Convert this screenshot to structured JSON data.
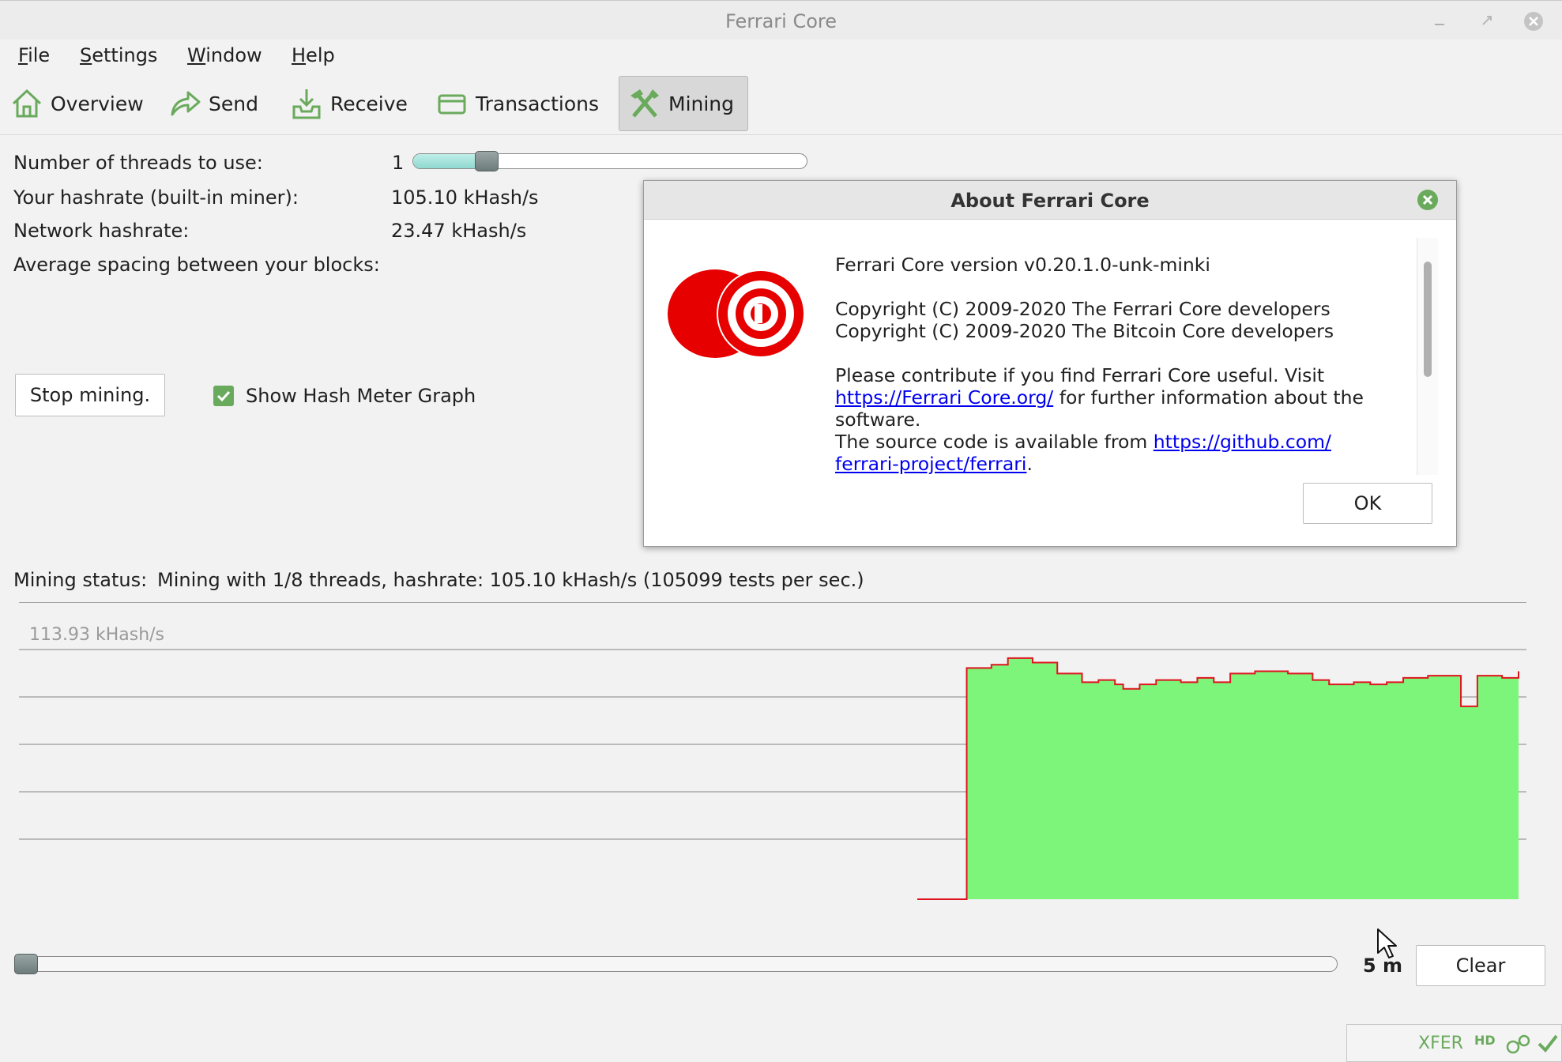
{
  "window": {
    "title": "Ferrari Core"
  },
  "menu": {
    "items": [
      {
        "mnemonic": "F",
        "rest": "ile"
      },
      {
        "mnemonic": "S",
        "rest": "ettings"
      },
      {
        "mnemonic": "W",
        "rest": "indow"
      },
      {
        "mnemonic": "H",
        "rest": "elp"
      }
    ]
  },
  "toolbar": {
    "overview": "Overview",
    "send": "Send",
    "receive": "Receive",
    "transactions": "Transactions",
    "mining": "Mining"
  },
  "mining": {
    "threads_label": "Number of threads to use:",
    "threads_value": "1",
    "threads_slider": {
      "value": 1,
      "max": 8
    },
    "hashrate_label": "Your hashrate (built-in miner):",
    "hashrate_value": "105.10 kHash/s",
    "network_label": "Network hashrate:",
    "network_value": "23.47 kHash/s",
    "spacing_label": "Average spacing between your blocks:",
    "stop_button": "Stop mining.",
    "show_graph_label": "Show Hash Meter Graph",
    "show_graph_checked": true,
    "status_label": "Mining status:",
    "status_value": "Mining with 1/8 threads, hashrate: 105.10 kHash/s (105099 tests per sec.)",
    "graph_max_label": "113.93 kHash/s",
    "interval_label": "5 m",
    "interval_slider": {
      "value": 0
    },
    "clear_button": "Clear"
  },
  "graph": {
    "max": 113.93,
    "samples": [
      0,
      0,
      0,
      0,
      0,
      0,
      105.5,
      105.5,
      105.5,
      107,
      107,
      110,
      110,
      110,
      108,
      108,
      108,
      103,
      103,
      103,
      99,
      99,
      100,
      100,
      98,
      96,
      96,
      98,
      98,
      100,
      100,
      100,
      99,
      99,
      101,
      101,
      99,
      99,
      103,
      103,
      103,
      104,
      104,
      104,
      104,
      103,
      103,
      103,
      100,
      100,
      98,
      98,
      98,
      99,
      99,
      98,
      98,
      99,
      99,
      101,
      101,
      101,
      102,
      102,
      102,
      102,
      88,
      88,
      102,
      102,
      102,
      101,
      101,
      104
    ]
  },
  "about": {
    "title": "About Ferrari Core",
    "version": "Ferrari Core version v0.20.1.0-unk-minki",
    "copyright1": "Copyright (C) 2009-2020 The Ferrari Core developers",
    "copyright2": "Copyright (C) 2009-2020 The Bitcoin Core developers",
    "contribute": "Please contribute if you find Ferrari Core useful. Visit",
    "site_link": "https://Ferrari Core.org/",
    "site_after": " for further information about the",
    "software": "software.",
    "source_before": "The source code is available from ",
    "source_link_1": "https://github.com/",
    "source_link_2": "ferrari-project/ferrari",
    "source_after": ".",
    "ok_button": "OK"
  },
  "statusbar": {
    "unit": "XFER",
    "hd": "HD"
  },
  "colors": {
    "graph_fill": "#7df57a",
    "graph_line": "#e0141e",
    "accent": "#6aaa5c",
    "logo_red": "#e60000"
  }
}
